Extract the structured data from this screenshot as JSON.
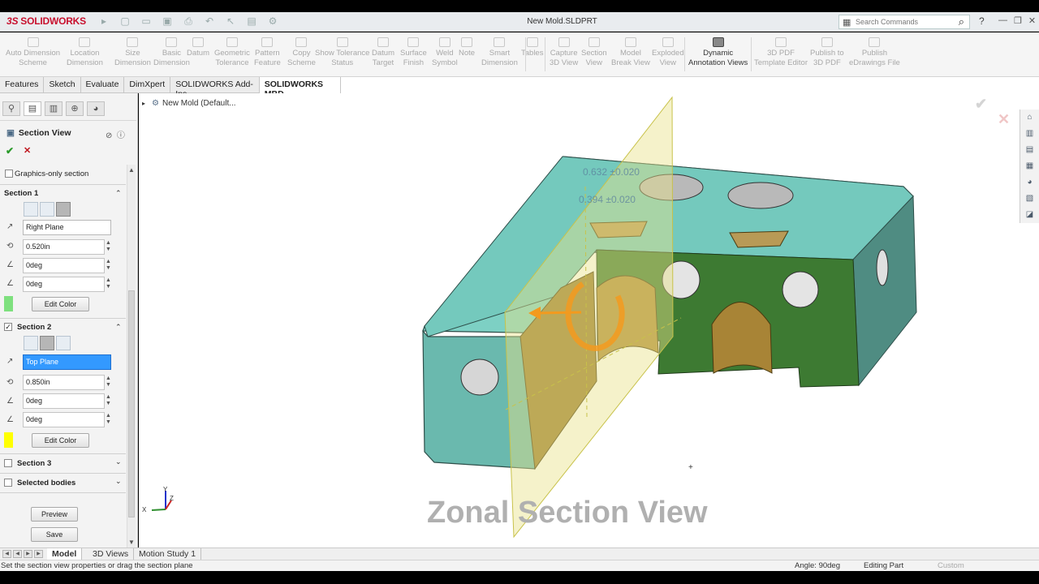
{
  "app": {
    "logo": "SOLIDWORKS",
    "logo_mark": "3S",
    "document_title": "New Mold.SLDPRT",
    "search_placeholder": "Search Commands",
    "help_label": "?"
  },
  "commandbar": {
    "commands": [
      {
        "label": "Auto Dimension\nScheme",
        "enabled": false
      },
      {
        "label": "Location\nDimension",
        "enabled": false
      },
      {
        "label": "Size\nDimension",
        "enabled": false
      },
      {
        "label": "Basic\nDimension",
        "enabled": false
      },
      {
        "label": "Datum",
        "enabled": false
      },
      {
        "label": "Geometric\nTolerance",
        "enabled": false
      },
      {
        "label": "Pattern\nFeature",
        "enabled": false
      },
      {
        "label": "Copy\nScheme",
        "enabled": false
      },
      {
        "label": "Show Tolerance\nStatus",
        "enabled": false
      },
      {
        "label": "Datum\nTarget",
        "enabled": false
      },
      {
        "label": "Surface\nFinish",
        "enabled": false
      },
      {
        "label": "Weld\nSymbol",
        "enabled": false
      },
      {
        "label": "Note",
        "enabled": false
      },
      {
        "label": "Smart\nDimension",
        "enabled": false
      },
      {
        "label": "Tables",
        "enabled": false
      },
      {
        "label": "Capture\n3D View",
        "enabled": false
      },
      {
        "label": "Section\nView",
        "enabled": false
      },
      {
        "label": "Model\nBreak View",
        "enabled": false
      },
      {
        "label": "Exploded\nView",
        "enabled": false
      },
      {
        "label": "Dynamic\nAnnotation Views",
        "enabled": true
      },
      {
        "label": "3D PDF\nTemplate Editor",
        "enabled": false
      },
      {
        "label": "Publish to\n3D PDF",
        "enabled": false
      },
      {
        "label": "Publish\neDrawings File",
        "enabled": false
      }
    ]
  },
  "tabs": [
    {
      "label": "Features",
      "active": false
    },
    {
      "label": "Sketch",
      "active": false
    },
    {
      "label": "Evaluate",
      "active": false
    },
    {
      "label": "DimXpert",
      "active": false
    },
    {
      "label": "SOLIDWORKS Add-Ins",
      "active": false
    },
    {
      "label": "SOLIDWORKS MBD",
      "active": true
    }
  ],
  "property_manager": {
    "title": "Section View",
    "graphics_only_label": "Graphics-only section",
    "section1": {
      "title": "Section 1",
      "plane": "Right Plane",
      "offset": "0.520in",
      "angle_x": "0deg",
      "angle_y": "0deg",
      "color_button": "Edit Color",
      "color": "#7ee07e"
    },
    "section2": {
      "title": "Section 2",
      "checked": true,
      "plane": "Top Plane",
      "offset": "0.850in",
      "angle_x": "0deg",
      "angle_y": "0deg",
      "color_button": "Edit Color",
      "color": "#ffff00"
    },
    "section3": {
      "title": "Section 3",
      "checked": false
    },
    "selected_bodies": {
      "title": "Selected bodies",
      "checked": false
    },
    "preview_button": "Preview",
    "save_button": "Save"
  },
  "viewport": {
    "tree_label": "New Mold  (Default...",
    "dimension_1": "0.632 ±0.020",
    "dimension_2": "0.394 ±0.020",
    "watermark": "Zonal Section View",
    "triad_x": "X",
    "triad_y": "Y",
    "triad_z": "Z"
  },
  "bottom_tabs": [
    {
      "label": "Model",
      "active": true
    },
    {
      "label": "3D Views",
      "active": false
    },
    {
      "label": "Motion Study 1",
      "active": false
    }
  ],
  "status": {
    "message": "Set the section view properties or drag the section plane",
    "angle": "Angle: 90deg",
    "mode": "Editing Part",
    "units": "Custom"
  },
  "colors": {
    "part_cyan": "#69c4b8",
    "section_green": "#3d7a32",
    "brass": "#b08a3a",
    "plane_yellow": "#e8e38a",
    "drag_handle_orange": "#f39a1e"
  }
}
